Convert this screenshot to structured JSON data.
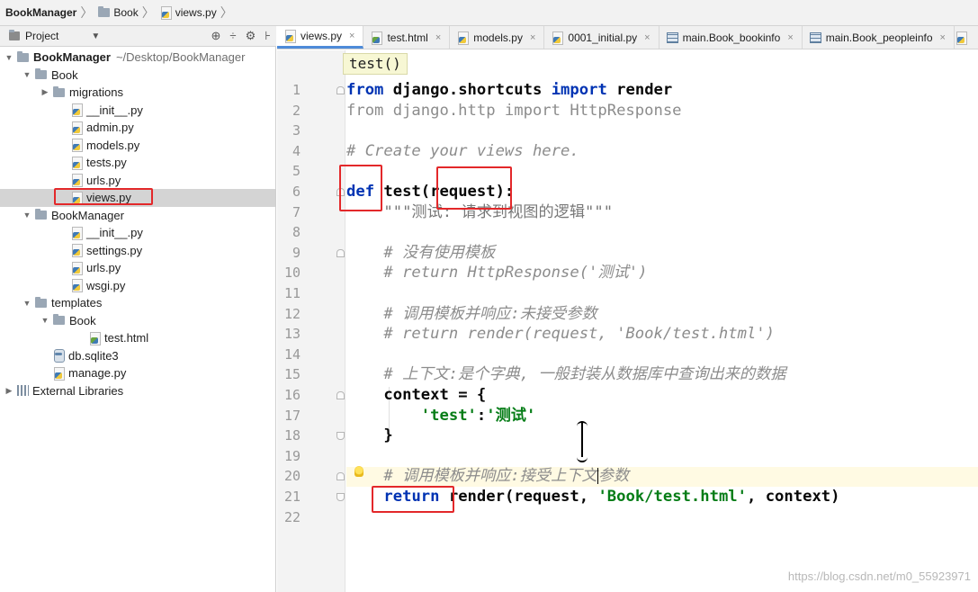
{
  "breadcrumb": [
    {
      "label": "BookManager",
      "bold": true,
      "icon": "folder-icon"
    },
    {
      "label": "Book",
      "bold": false,
      "icon": "folder-icon"
    },
    {
      "label": "views.py",
      "bold": false,
      "icon": "python-file-icon"
    }
  ],
  "project_panel": {
    "title": "Project",
    "tools": [
      "⊕",
      "÷",
      "⚙",
      "⊦"
    ]
  },
  "tree": [
    {
      "label": "BookManager",
      "path": "~/Desktop/BookManager",
      "indent": 0,
      "arrow": "▼",
      "icon": "folder",
      "bold": true
    },
    {
      "label": "Book",
      "indent": 1,
      "arrow": "▼",
      "icon": "folder"
    },
    {
      "label": "migrations",
      "indent": 2,
      "arrow": "▶",
      "icon": "folder"
    },
    {
      "label": "__init__.py",
      "indent": 3,
      "icon": "py"
    },
    {
      "label": "admin.py",
      "indent": 3,
      "icon": "py"
    },
    {
      "label": "models.py",
      "indent": 3,
      "icon": "py"
    },
    {
      "label": "tests.py",
      "indent": 3,
      "icon": "py"
    },
    {
      "label": "urls.py",
      "indent": 3,
      "icon": "py"
    },
    {
      "label": "views.py",
      "indent": 3,
      "icon": "py",
      "selected": true
    },
    {
      "label": "BookManager",
      "indent": 1,
      "arrow": "▼",
      "icon": "folder"
    },
    {
      "label": "__init__.py",
      "indent": 3,
      "icon": "py"
    },
    {
      "label": "settings.py",
      "indent": 3,
      "icon": "py"
    },
    {
      "label": "urls.py",
      "indent": 3,
      "icon": "py"
    },
    {
      "label": "wsgi.py",
      "indent": 3,
      "icon": "py"
    },
    {
      "label": "templates",
      "indent": 1,
      "arrow": "▼",
      "icon": "folder"
    },
    {
      "label": "Book",
      "indent": 2,
      "arrow": "▼",
      "icon": "folder"
    },
    {
      "label": "test.html",
      "indent": 4,
      "icon": "html"
    },
    {
      "label": "db.sqlite3",
      "indent": 2,
      "icon": "db"
    },
    {
      "label": "manage.py",
      "indent": 2,
      "icon": "py"
    },
    {
      "label": "External Libraries",
      "indent": 0,
      "arrow": "▶",
      "icon": "lib"
    }
  ],
  "tabs": [
    {
      "label": "views.py",
      "icon": "py",
      "active": true
    },
    {
      "label": "test.html",
      "icon": "html"
    },
    {
      "label": "models.py",
      "icon": "py"
    },
    {
      "label": "0001_initial.py",
      "icon": "py"
    },
    {
      "label": "main.Book_bookinfo",
      "icon": "table"
    },
    {
      "label": "main.Book_peopleinfo",
      "icon": "table"
    }
  ],
  "tab_close": "×",
  "tooltip": "test()",
  "line_numbers": [
    "1",
    "2",
    "3",
    "4",
    "5",
    "6",
    "7",
    "8",
    "9",
    "10",
    "11",
    "12",
    "13",
    "14",
    "15",
    "16",
    "17",
    "18",
    "19",
    "20",
    "21",
    "22"
  ],
  "code": [
    [
      {
        "t": "from",
        "c": "kw"
      },
      {
        "t": " "
      },
      {
        "t": "django.shortcuts",
        "c": "nm"
      },
      {
        "t": " "
      },
      {
        "t": "import",
        "c": "kw"
      },
      {
        "t": " "
      },
      {
        "t": "render",
        "c": "nm"
      }
    ],
    [
      {
        "t": "from django.http import HttpResponse",
        "c": "dim"
      }
    ],
    [],
    [
      {
        "t": "# Create your views here.",
        "c": "cm"
      }
    ],
    [],
    [
      {
        "t": "def",
        "c": "kw"
      },
      {
        "t": " "
      },
      {
        "t": "test(request):",
        "c": "nm"
      }
    ],
    [
      {
        "t": "    \"\"\"测试: 请求到视图的逻辑\"\"\"",
        "c": "doc"
      }
    ],
    [],
    [
      {
        "t": "    # 没有使用模板",
        "c": "cm"
      }
    ],
    [
      {
        "t": "    # return HttpResponse('测试')",
        "c": "cm"
      }
    ],
    [],
    [
      {
        "t": "    # 调用模板并响应:未接受参数",
        "c": "cm"
      }
    ],
    [
      {
        "t": "    # return render(request, 'Book/test.html')",
        "c": "cm"
      }
    ],
    [],
    [
      {
        "t": "    # 上下文:是个字典, 一般封装从数据库中查询出来的数据",
        "c": "cm"
      }
    ],
    [
      {
        "t": "    "
      },
      {
        "t": "context = {",
        "c": "nm"
      }
    ],
    [
      {
        "t": "        "
      },
      {
        "t": "'test'",
        "c": "str"
      },
      {
        "t": ":",
        "c": "nm"
      },
      {
        "t": "'测试'",
        "c": "str"
      }
    ],
    [
      {
        "t": "    "
      },
      {
        "t": "}",
        "c": "nm"
      }
    ],
    [],
    [
      {
        "t": "    # 调用模板并响应:接受上下文",
        "c": "cm"
      },
      {
        "caret": true
      },
      {
        "t": "参数",
        "c": "cm"
      }
    ],
    [
      {
        "t": "    "
      },
      {
        "t": "return",
        "c": "kw"
      },
      {
        "t": " "
      },
      {
        "t": "render(request, ",
        "c": "nm"
      },
      {
        "t": "'Book/test.html'",
        "c": "str"
      },
      {
        "t": ", context)",
        "c": "nm"
      }
    ],
    []
  ],
  "watermark": "https://blog.csdn.net/m0_55923971",
  "colors": {
    "keyword": "#0033b3",
    "string": "#067d17",
    "comment": "#8c8c8c",
    "annotation_box": "#e3282a",
    "active_tab_underline": "#4e8bd9"
  }
}
